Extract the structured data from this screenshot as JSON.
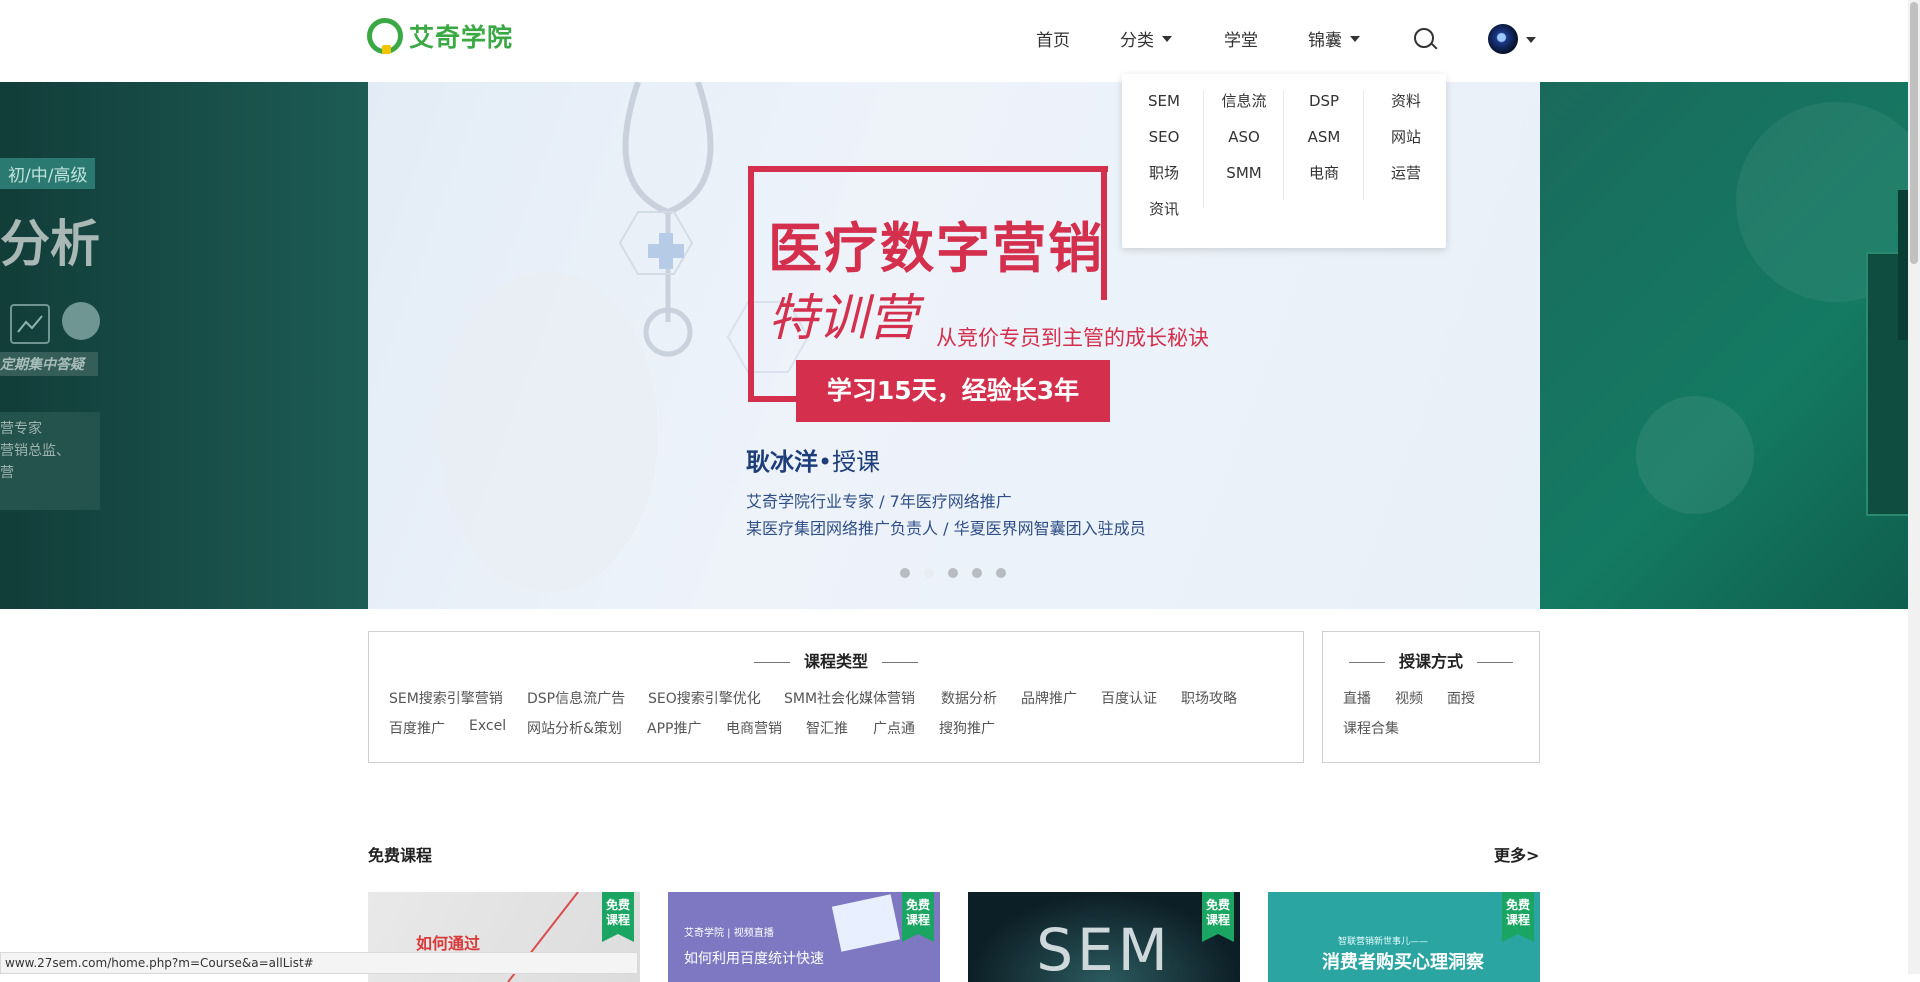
{
  "header": {
    "logo_text": "艾奇学院",
    "nav": [
      {
        "label": "首页"
      },
      {
        "label": "分类"
      },
      {
        "label": "学堂"
      },
      {
        "label": "锦囊"
      }
    ]
  },
  "category_dropdown": {
    "col1": [
      "SEM",
      "SEO",
      "职场",
      "资讯"
    ],
    "col2": [
      "信息流",
      "ASO",
      "SMM"
    ],
    "col3": [
      "DSP",
      "ASM",
      "电商"
    ],
    "col4": [
      "资料",
      "网站",
      "运营"
    ]
  },
  "banner_left": {
    "level": "初/中/高级",
    "title": "分析",
    "tag": "定期集中答疑",
    "lines": [
      "营专家",
      "营销总监、",
      "营"
    ]
  },
  "banner": {
    "title": "医疗数字营销",
    "script": "特训营",
    "tagline": "从竞价专员到主管的成长秘诀",
    "cta": "学习15天，经验长3年",
    "teacher_name": "耿冰洋",
    "teacher_role": "•授课",
    "desc1": "艾奇学院行业专家 / 7年医疗网络推广",
    "desc2": "某医疗集团网络推广负责人 / 华夏医界网智囊团入驻成员",
    "slides": 5,
    "active_slide": 2
  },
  "course_types": {
    "title": "课程类型",
    "row1": [
      "SEM搜索引擎营销",
      "DSP信息流广告",
      "SEO搜索引擎优化",
      "SMM社会化媒体营销",
      "数据分析",
      "品牌推广",
      "百度认证",
      "职场攻略"
    ],
    "row2": [
      "百度推广",
      "Excel",
      "网站分析&策划",
      "APP推广",
      "电商营销",
      "智汇推",
      "广点通",
      "搜狗推广"
    ]
  },
  "teaching_modes": {
    "title": "授课方式",
    "row1": [
      "直播",
      "视频",
      "面授"
    ],
    "row2": [
      "课程合集"
    ]
  },
  "free_courses": {
    "title": "免费课程",
    "more": "更多>",
    "badge": "免费\n课程",
    "cards": [
      {
        "text": "如何通过"
      },
      {
        "brand": "艾奇学院 | 视频直播",
        "text": "如何利用百度统计快速"
      },
      {
        "text": "SEM"
      },
      {
        "pre": "智联营销新世事儿——",
        "text": "消费者购买心理洞察"
      }
    ]
  },
  "status_url": "www.27sem.com/home.php?m=Course&a=allList#",
  "colors": {
    "brand_green": "#3aa843",
    "banner_red": "#d42f4c",
    "badge_green": "#1aa563"
  }
}
